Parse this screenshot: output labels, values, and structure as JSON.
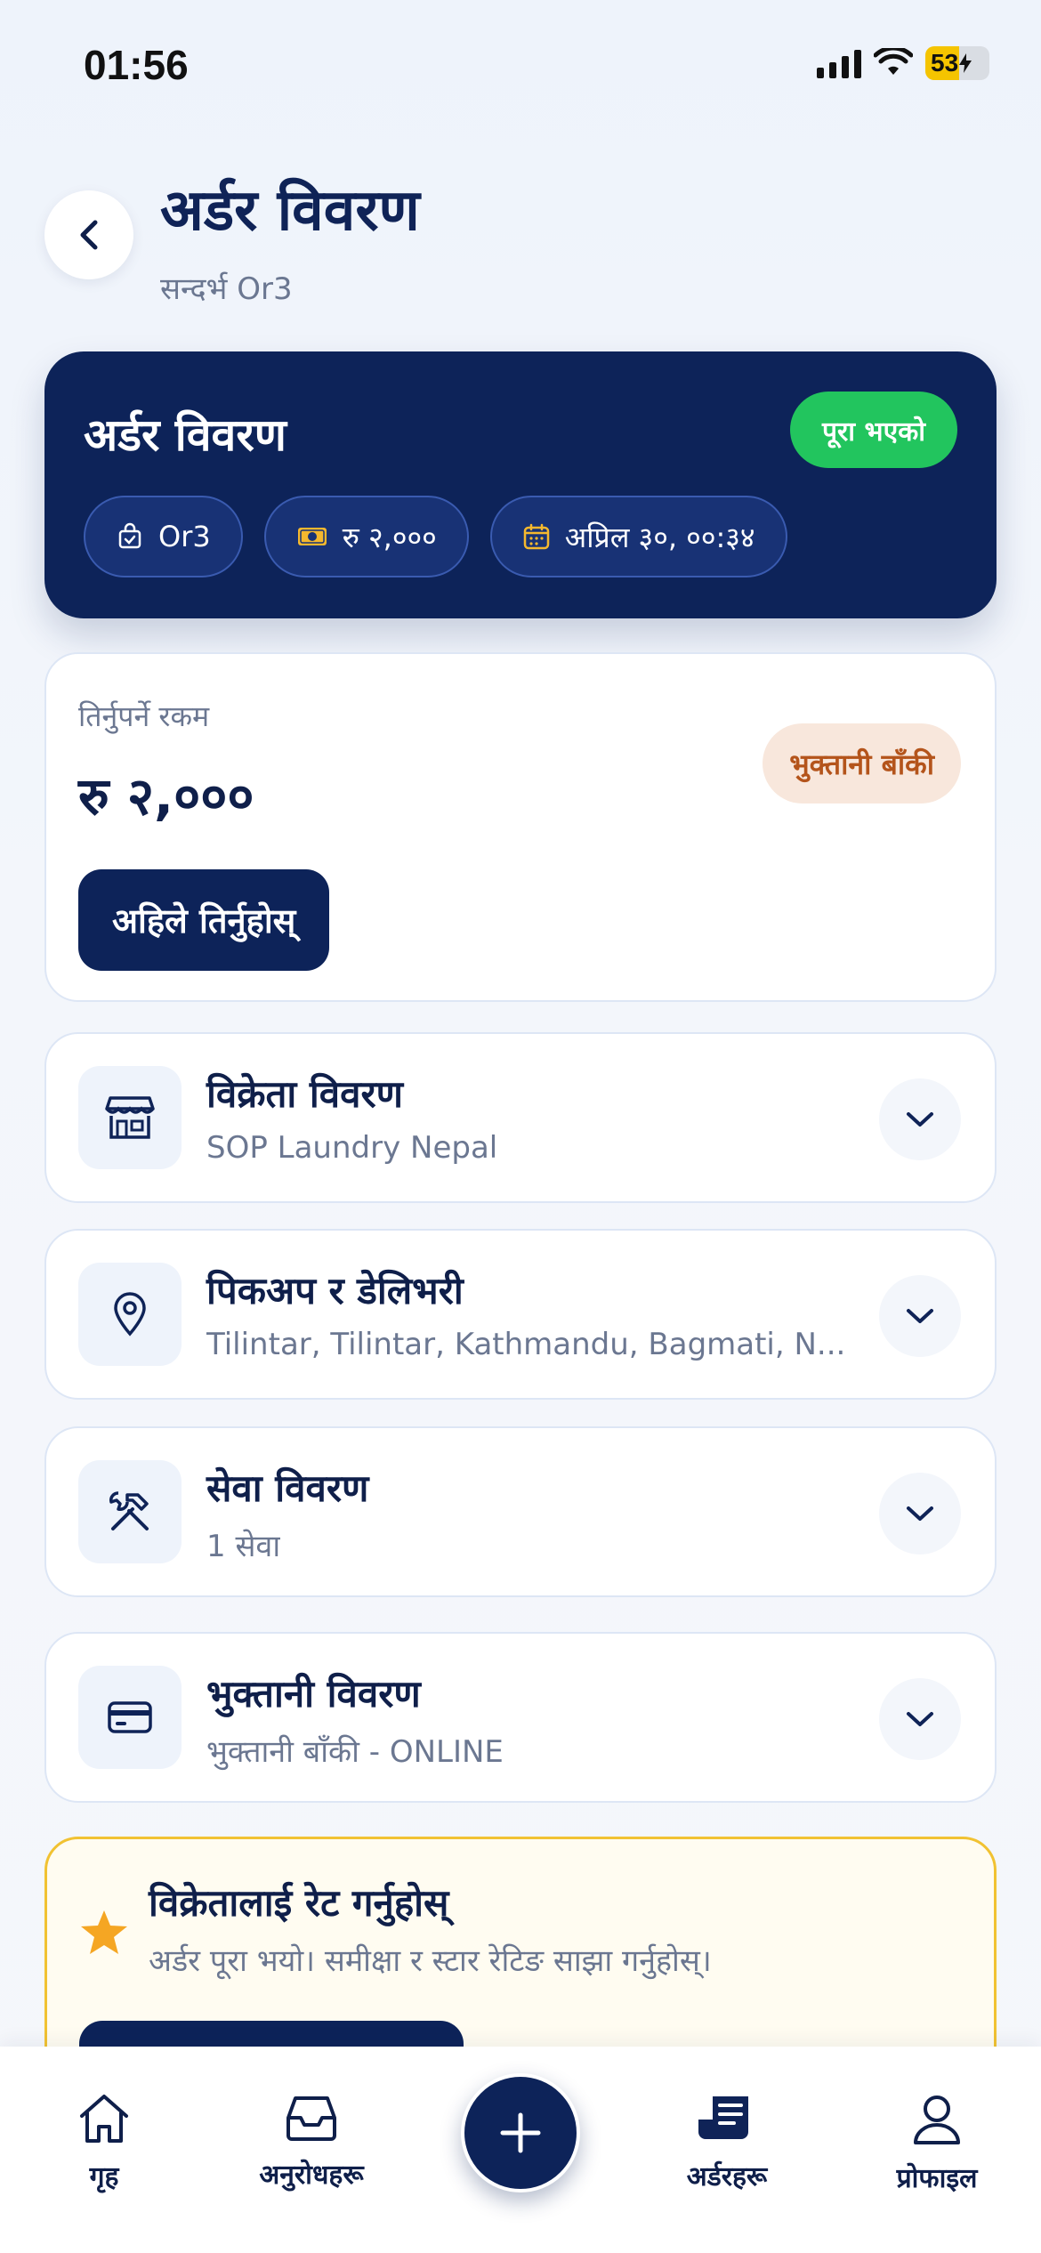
{
  "status_bar": {
    "time": "01:56",
    "battery": "53",
    "battery_level_percent": 53
  },
  "header": {
    "title": "अर्डर विवरण",
    "subtitle": "सन्दर्भ Or3"
  },
  "order_card": {
    "title": "अर्डर विवरण",
    "status": "पूरा भएको",
    "order_id": "Or3",
    "amount": "रु २,०००",
    "date": "अप्रिल ३०, ००:३४"
  },
  "payment": {
    "label": "तिर्नुपर्ने रकम",
    "amount": "रु २,०००",
    "status": "भुक्तानी बाँकी",
    "pay_button": "अहिले तिर्नुहोस्"
  },
  "sections": [
    {
      "title": "विक्रेता विवरण",
      "subtitle": "SOP Laundry Nepal",
      "icon": "store-icon"
    },
    {
      "title": "पिकअप र डेलिभरी",
      "subtitle": "Tilintar, Tilintar, Kathmandu, Bagmati, N...",
      "icon": "location-pin-icon"
    },
    {
      "title": "सेवा विवरण",
      "subtitle": "1 सेवा",
      "icon": "tools-icon"
    },
    {
      "title": "भुक्तानी विवरण",
      "subtitle": "भुक्तानी बाँकी - ONLINE",
      "icon": "credit-card-icon"
    }
  ],
  "rating": {
    "title": "विक्रेतालाई रेट गर्नुहोस्",
    "subtitle": "अर्डर पूरा भयो। समीक्षा र स्टार रेटिङ साझा गर्नुहोस्।"
  },
  "bottom_nav": {
    "items": [
      {
        "label": "गृह",
        "icon": "home-icon"
      },
      {
        "label": "अनुरोधहरू",
        "icon": "inbox-icon"
      },
      {
        "label": "अर्डरहरू",
        "icon": "receipt-icon"
      },
      {
        "label": "प्रोफाइल",
        "icon": "user-icon"
      }
    ],
    "fab_icon": "plus-icon"
  },
  "colors": {
    "navy": "#0d2359",
    "success": "#22c55e",
    "warning_bg": "#f8e7dc",
    "warning_text": "#b4541b",
    "star": "#f5a623"
  }
}
